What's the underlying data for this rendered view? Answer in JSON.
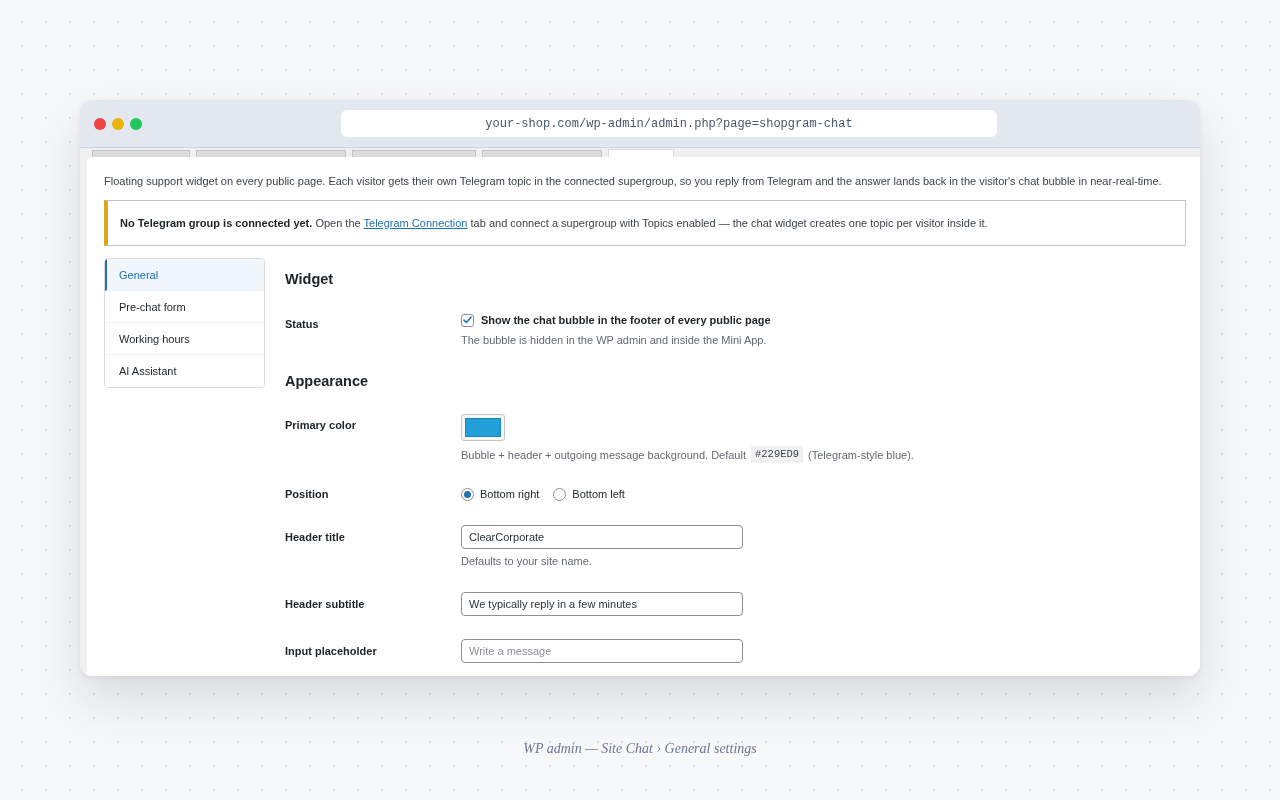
{
  "browser": {
    "url": "your-shop.com/wp-admin/admin.php?page=shopgram-chat"
  },
  "nav_tabs": [
    {
      "selected": false
    },
    {
      "selected": false
    },
    {
      "selected": false
    },
    {
      "selected": false
    },
    {
      "selected": true
    }
  ],
  "intro": "Floating support widget on every public page. Each visitor gets their own Telegram topic in the connected supergroup, so you reply from Telegram and the answer lands back in the visitor's chat bubble in near-real-time.",
  "notice": {
    "before": "**No Telegram group is connected yet.** Open the",
    "link": "Telegram Connection",
    "after": "tab and connect a supergroup with Topics enabled — the chat widget creates one topic per visitor inside it."
  },
  "sidebar": {
    "items": [
      {
        "label": "General",
        "selected": true
      },
      {
        "label": "Pre-chat form",
        "selected": false
      },
      {
        "label": "Working hours",
        "selected": false
      },
      {
        "label": "AI Assistant",
        "selected": false
      }
    ]
  },
  "sections": [
    {
      "heading": "Widget",
      "rows": [
        {
          "kind": "checkbox",
          "label": "Status",
          "option": "Show the chat bubble in the footer of every public page",
          "checked": true,
          "description": "The bubble is hidden in the WP admin and inside the Mini App."
        }
      ]
    },
    {
      "heading": "Appearance",
      "rows": [
        {
          "kind": "color",
          "label": "Primary color",
          "color": "#229ed9",
          "description_before": "Bubble + header + outgoing message background. Default",
          "code": "#229ED9",
          "description_after": "(Telegram-style blue)."
        },
        {
          "kind": "radio",
          "label": "Position",
          "options": [
            {
              "label": "Bottom right",
              "selected": true
            },
            {
              "label": "Bottom left",
              "selected": false
            }
          ]
        },
        {
          "kind": "text",
          "label": "Header title",
          "value": "ClearCorporate",
          "description": "Defaults to your site name."
        },
        {
          "kind": "text",
          "label": "Header subtitle",
          "value": "We typically reply in a few minutes"
        },
        {
          "kind": "text",
          "label": "Input placeholder",
          "placeholder": "Write a message"
        }
      ]
    }
  ],
  "caption": "WP admin — Site Chat › General settings"
}
